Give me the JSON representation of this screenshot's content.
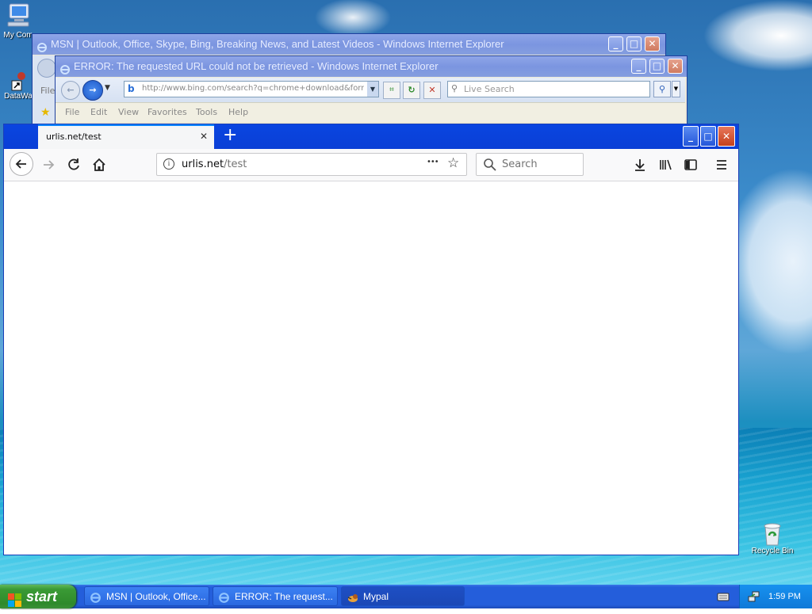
{
  "desktop": {
    "icons": [
      {
        "label": "My Computer",
        "visible_label": "My Com",
        "name": "my-computer-icon"
      },
      {
        "label": "DataWa",
        "name": "datawa-shortcut-icon"
      },
      {
        "label": "Recycle Bin",
        "name": "recycle-bin-icon"
      }
    ]
  },
  "ie_msn": {
    "title": "MSN | Outlook, Office, Skype, Bing, Breaking News, and Latest Videos - Windows Internet Explorer",
    "menu_partial": "File"
  },
  "ie_error": {
    "title": "ERROR: The requested URL could not be retrieved - Windows Internet Explorer",
    "address": "http://www.bing.com/search?q=chrome+download&form=",
    "search_placeholder": "Live Search",
    "menu": [
      "File",
      "Edit",
      "View",
      "Favorites",
      "Tools",
      "Help"
    ]
  },
  "firefox": {
    "tab_title": "urlis.net/test",
    "url_host": "urlis.net",
    "url_path": "/test",
    "search_placeholder": "Search",
    "new_tab_symbol": "+",
    "tab_close_symbol": "✕",
    "overflow_symbol": "•••"
  },
  "window_controls": {
    "minimize": "_",
    "maximize": "□",
    "close": "✕"
  },
  "taskbar": {
    "start_label": "start",
    "items": [
      {
        "label": "MSN | Outlook, Office...",
        "icon": "ie-icon"
      },
      {
        "label": "ERROR: The request...",
        "icon": "ie-icon"
      },
      {
        "label": "Mypal",
        "icon": "mypal-icon"
      }
    ],
    "clock": "1:59 PM"
  },
  "colors": {
    "xp_title": "#1a4bd0",
    "ff_accent": "#0a84ff",
    "start_green": "#3a9a35"
  }
}
